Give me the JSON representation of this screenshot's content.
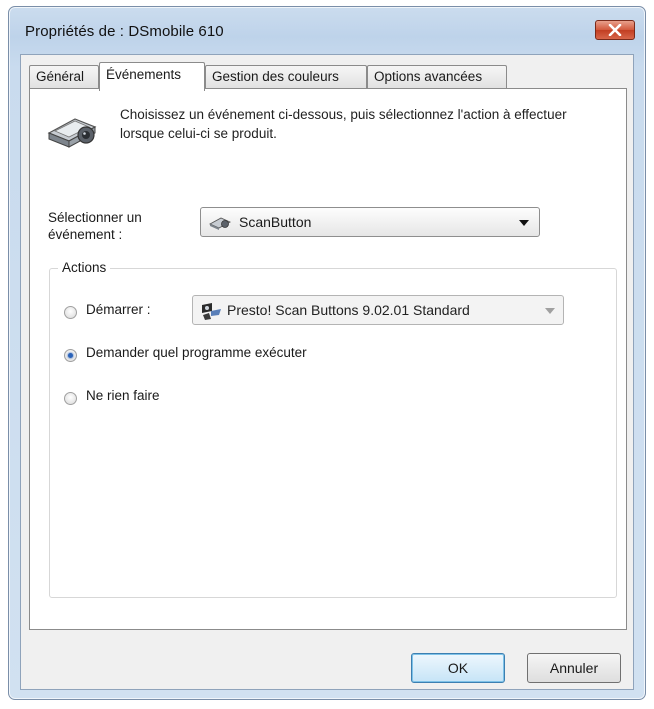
{
  "window": {
    "title": "Propriétés de : DSmobile 610",
    "close_icon": "close-icon"
  },
  "tabs": [
    {
      "label": "Général",
      "active": false
    },
    {
      "label": "Événements",
      "active": true
    },
    {
      "label": "Gestion des couleurs",
      "active": false
    },
    {
      "label": "Options avancées",
      "active": false
    }
  ],
  "events_tab": {
    "icon": "scanner-icon",
    "description": "Choisissez un événement ci-dessous, puis sélectionnez l'action à effectuer lorsque celui-ci se produit.",
    "select_label": "Sélectionner un événement :",
    "selected_event": "ScanButton",
    "event_icon": "scanbutton-icon",
    "actions": {
      "group_title": "Actions",
      "start_label": "Démarrer :",
      "start_program": "Presto! Scan Buttons 9.02.01 Standard",
      "program_icon": "program-icon",
      "ask_label": "Demander quel programme exécuter",
      "nothing_label": "Ne rien faire",
      "selected_option": "ask"
    }
  },
  "buttons": {
    "ok": "OK",
    "cancel": "Annuler"
  },
  "colors": {
    "title_bar": "#bed3ea",
    "close_button": "#c8452a",
    "default_button_border": "#3c7fb1",
    "radio_dot": "#2a62b8"
  }
}
